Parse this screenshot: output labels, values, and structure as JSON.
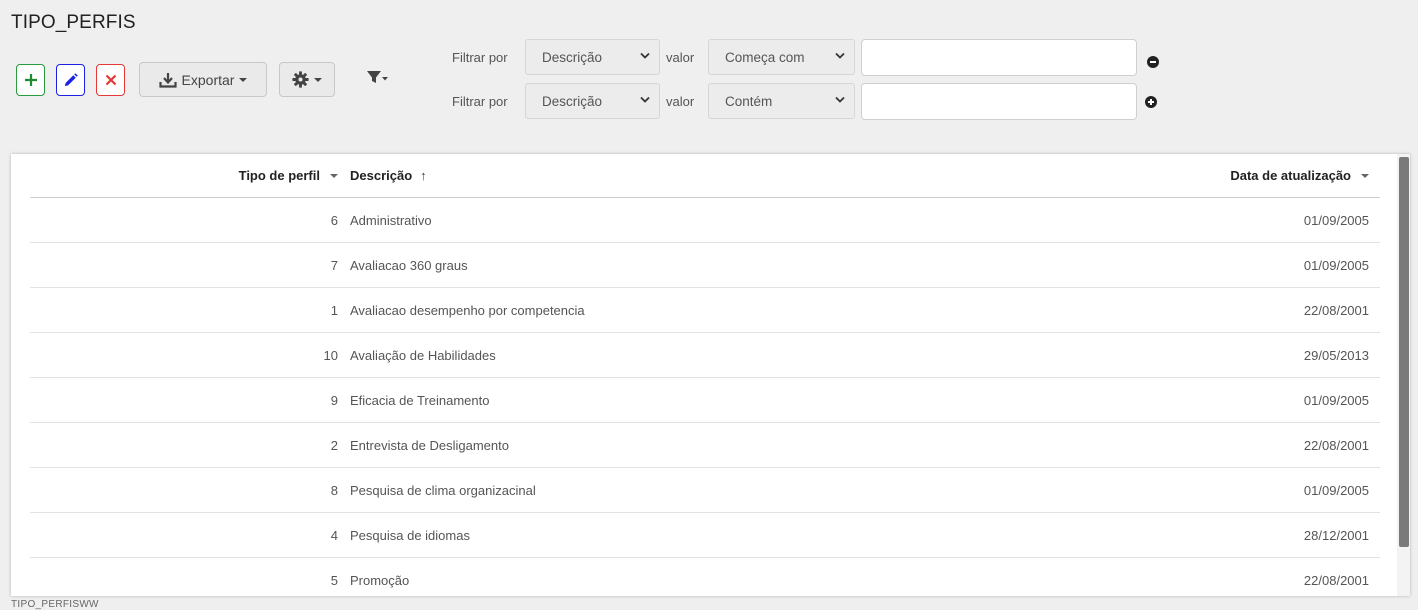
{
  "page_title": "TIPO_PERFIS",
  "toolbar": {
    "export_label": "Exportar",
    "add_color": "#2a9a3c",
    "edit_color": "#1a22e6",
    "delete_color": "#e53935"
  },
  "filters": [
    {
      "filter_label": "Filtrar por",
      "field": "Descrição",
      "value_label": "valor",
      "operator": "Começa com",
      "value": "",
      "action_icon": "minus-circle-icon"
    },
    {
      "filter_label": "Filtrar por",
      "field": "Descrição",
      "value_label": "valor",
      "operator": "Contém",
      "value": "",
      "action_icon": "plus-circle-icon"
    }
  ],
  "table": {
    "columns": [
      "Tipo de perfil",
      "Descrição",
      "Data de atualização"
    ],
    "rows": [
      {
        "id": "6",
        "description": "Administrativo",
        "date": "01/09/2005"
      },
      {
        "id": "7",
        "description": "Avaliacao 360 graus",
        "date": "01/09/2005"
      },
      {
        "id": "1",
        "description": "Avaliacao desempenho por competencia",
        "date": "22/08/2001"
      },
      {
        "id": "10",
        "description": "Avaliação de Habilidades",
        "date": "29/05/2013"
      },
      {
        "id": "9",
        "description": "Eficacia de Treinamento",
        "date": "01/09/2005"
      },
      {
        "id": "2",
        "description": "Entrevista de Desligamento",
        "date": "22/08/2001"
      },
      {
        "id": "8",
        "description": "Pesquisa de clima organizacinal",
        "date": "01/09/2005"
      },
      {
        "id": "4",
        "description": "Pesquisa de idiomas",
        "date": "28/12/2001"
      },
      {
        "id": "5",
        "description": "Promoção",
        "date": "22/08/2001"
      }
    ]
  },
  "footer_text": "TIPO_PERFISWW"
}
